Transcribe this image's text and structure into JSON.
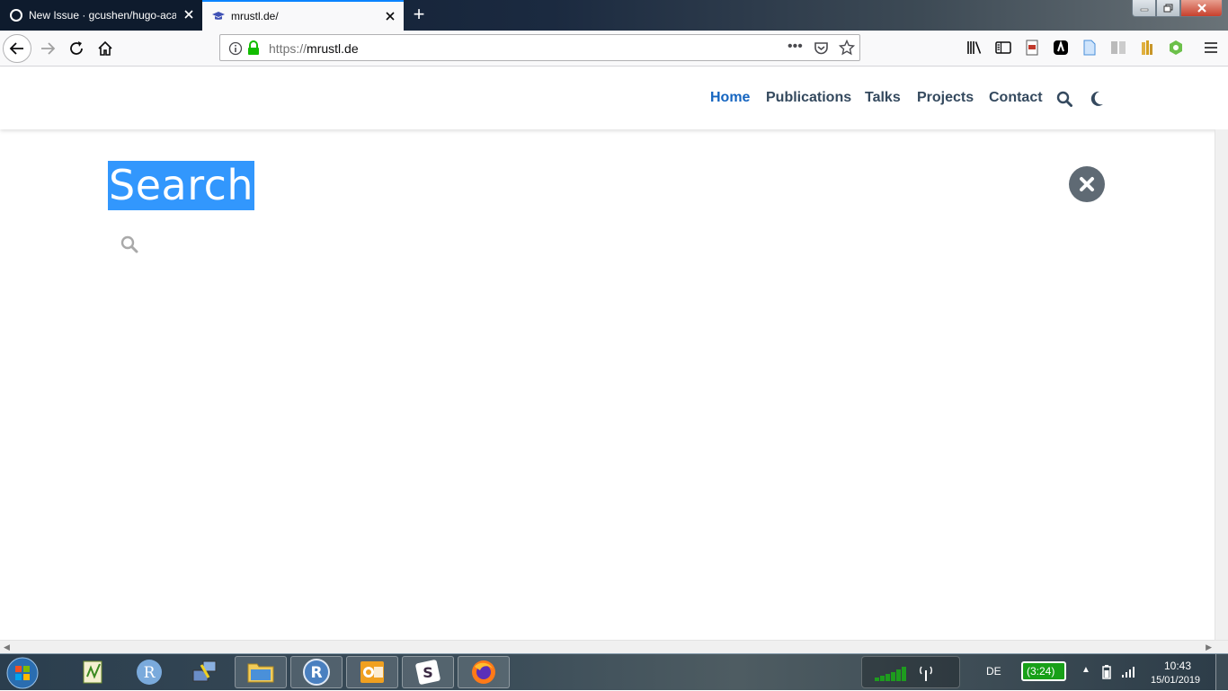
{
  "browser": {
    "tabs": [
      {
        "title": "New Issue · gcushen/hugo-aca",
        "icon": "github-icon",
        "active": false
      },
      {
        "title": "mrustl.de/",
        "icon": "graduation-cap-icon",
        "active": true
      }
    ],
    "new_tab_label": "+",
    "url": {
      "protocol": "https://",
      "host": "mrustl.de"
    },
    "page_actions_label": "•••"
  },
  "site": {
    "menu": [
      {
        "label": "Home",
        "active": true
      },
      {
        "label": "Publications",
        "active": false
      },
      {
        "label": "Talks",
        "active": false
      },
      {
        "label": "Projects",
        "active": false
      },
      {
        "label": "Contact",
        "active": false
      }
    ],
    "search": {
      "heading": "Search",
      "input_value": "",
      "input_placeholder": ""
    }
  },
  "taskbar": {
    "apps": [
      "textpad",
      "r-gui",
      "network-transfer",
      "file-explorer",
      "rstudio",
      "outlook",
      "slack",
      "firefox"
    ],
    "language": "DE",
    "battery": "(3:24)",
    "time": "10:43",
    "date": "15/01/2019"
  },
  "colors": {
    "accent_link": "#1565c0",
    "menu_text": "#34495e",
    "selection": "#3297fd",
    "close_badge": "#5f6a74"
  }
}
